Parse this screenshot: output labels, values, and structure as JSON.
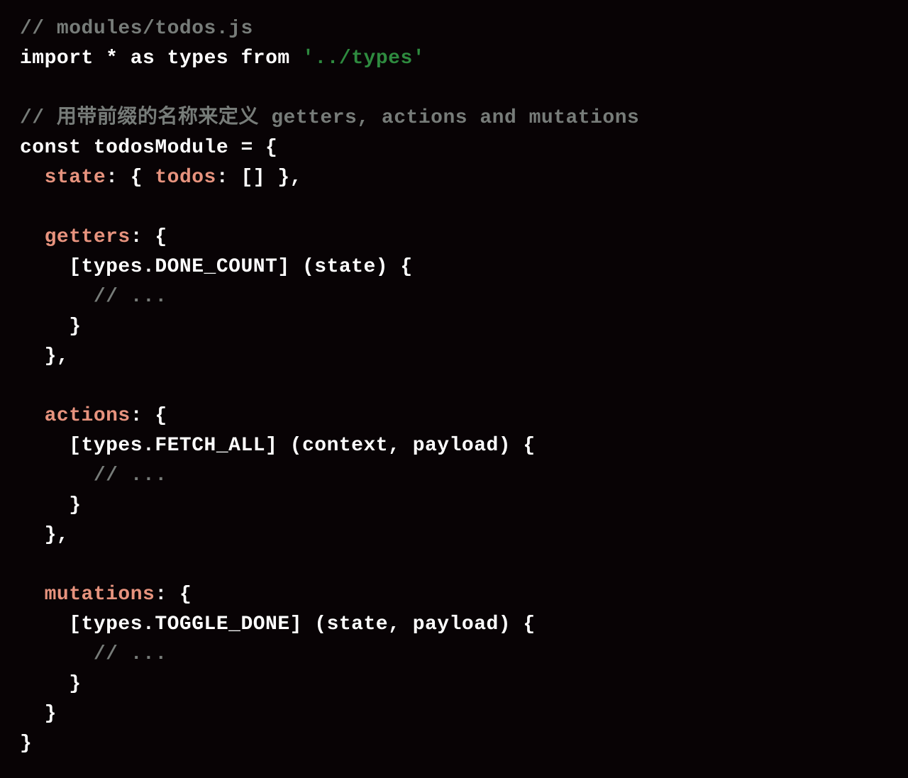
{
  "code": {
    "lines": [
      {
        "tokens": [
          {
            "cls": "tok-comment",
            "text": "// modules/todos.js"
          }
        ]
      },
      {
        "tokens": [
          {
            "cls": "tok-keyword",
            "text": "import"
          },
          {
            "cls": "tok-punct",
            "text": " * "
          },
          {
            "cls": "tok-keyword",
            "text": "as"
          },
          {
            "cls": "tok-ident",
            "text": " types "
          },
          {
            "cls": "tok-keyword",
            "text": "from"
          },
          {
            "cls": "tok-punct",
            "text": " "
          },
          {
            "cls": "tok-string",
            "text": "'../types'"
          }
        ]
      },
      {
        "tokens": [
          {
            "cls": "tok-punct",
            "text": ""
          }
        ]
      },
      {
        "tokens": [
          {
            "cls": "tok-comment",
            "text": "// 用带前缀的名称来定义 getters, actions and mutations"
          }
        ]
      },
      {
        "tokens": [
          {
            "cls": "tok-keyword",
            "text": "const"
          },
          {
            "cls": "tok-ident",
            "text": " todosModule "
          },
          {
            "cls": "tok-punct",
            "text": "= {"
          }
        ]
      },
      {
        "tokens": [
          {
            "cls": "tok-punct",
            "text": "  "
          },
          {
            "cls": "tok-prop",
            "text": "state"
          },
          {
            "cls": "tok-punct",
            "text": ": { "
          },
          {
            "cls": "tok-prop",
            "text": "todos"
          },
          {
            "cls": "tok-punct",
            "text": ": [] },"
          }
        ]
      },
      {
        "tokens": [
          {
            "cls": "tok-punct",
            "text": ""
          }
        ]
      },
      {
        "tokens": [
          {
            "cls": "tok-punct",
            "text": "  "
          },
          {
            "cls": "tok-prop",
            "text": "getters"
          },
          {
            "cls": "tok-punct",
            "text": ": {"
          }
        ]
      },
      {
        "tokens": [
          {
            "cls": "tok-punct",
            "text": "    [types.DONE_COUNT] (state) {"
          }
        ]
      },
      {
        "tokens": [
          {
            "cls": "tok-punct",
            "text": "      "
          },
          {
            "cls": "tok-comment",
            "text": "// ..."
          }
        ]
      },
      {
        "tokens": [
          {
            "cls": "tok-punct",
            "text": "    }"
          }
        ]
      },
      {
        "tokens": [
          {
            "cls": "tok-punct",
            "text": "  },"
          }
        ]
      },
      {
        "tokens": [
          {
            "cls": "tok-punct",
            "text": ""
          }
        ]
      },
      {
        "tokens": [
          {
            "cls": "tok-punct",
            "text": "  "
          },
          {
            "cls": "tok-prop",
            "text": "actions"
          },
          {
            "cls": "tok-punct",
            "text": ": {"
          }
        ]
      },
      {
        "tokens": [
          {
            "cls": "tok-punct",
            "text": "    [types.FETCH_ALL] (context, payload) {"
          }
        ]
      },
      {
        "tokens": [
          {
            "cls": "tok-punct",
            "text": "      "
          },
          {
            "cls": "tok-comment",
            "text": "// ..."
          }
        ]
      },
      {
        "tokens": [
          {
            "cls": "tok-punct",
            "text": "    }"
          }
        ]
      },
      {
        "tokens": [
          {
            "cls": "tok-punct",
            "text": "  },"
          }
        ]
      },
      {
        "tokens": [
          {
            "cls": "tok-punct",
            "text": ""
          }
        ]
      },
      {
        "tokens": [
          {
            "cls": "tok-punct",
            "text": "  "
          },
          {
            "cls": "tok-prop",
            "text": "mutations"
          },
          {
            "cls": "tok-punct",
            "text": ": {"
          }
        ]
      },
      {
        "tokens": [
          {
            "cls": "tok-punct",
            "text": "    [types.TOGGLE_DONE] (state, payload) {"
          }
        ]
      },
      {
        "tokens": [
          {
            "cls": "tok-punct",
            "text": "      "
          },
          {
            "cls": "tok-comment",
            "text": "// ..."
          }
        ]
      },
      {
        "tokens": [
          {
            "cls": "tok-punct",
            "text": "    }"
          }
        ]
      },
      {
        "tokens": [
          {
            "cls": "tok-punct",
            "text": "  }"
          }
        ]
      },
      {
        "tokens": [
          {
            "cls": "tok-punct",
            "text": "}"
          }
        ]
      }
    ]
  }
}
